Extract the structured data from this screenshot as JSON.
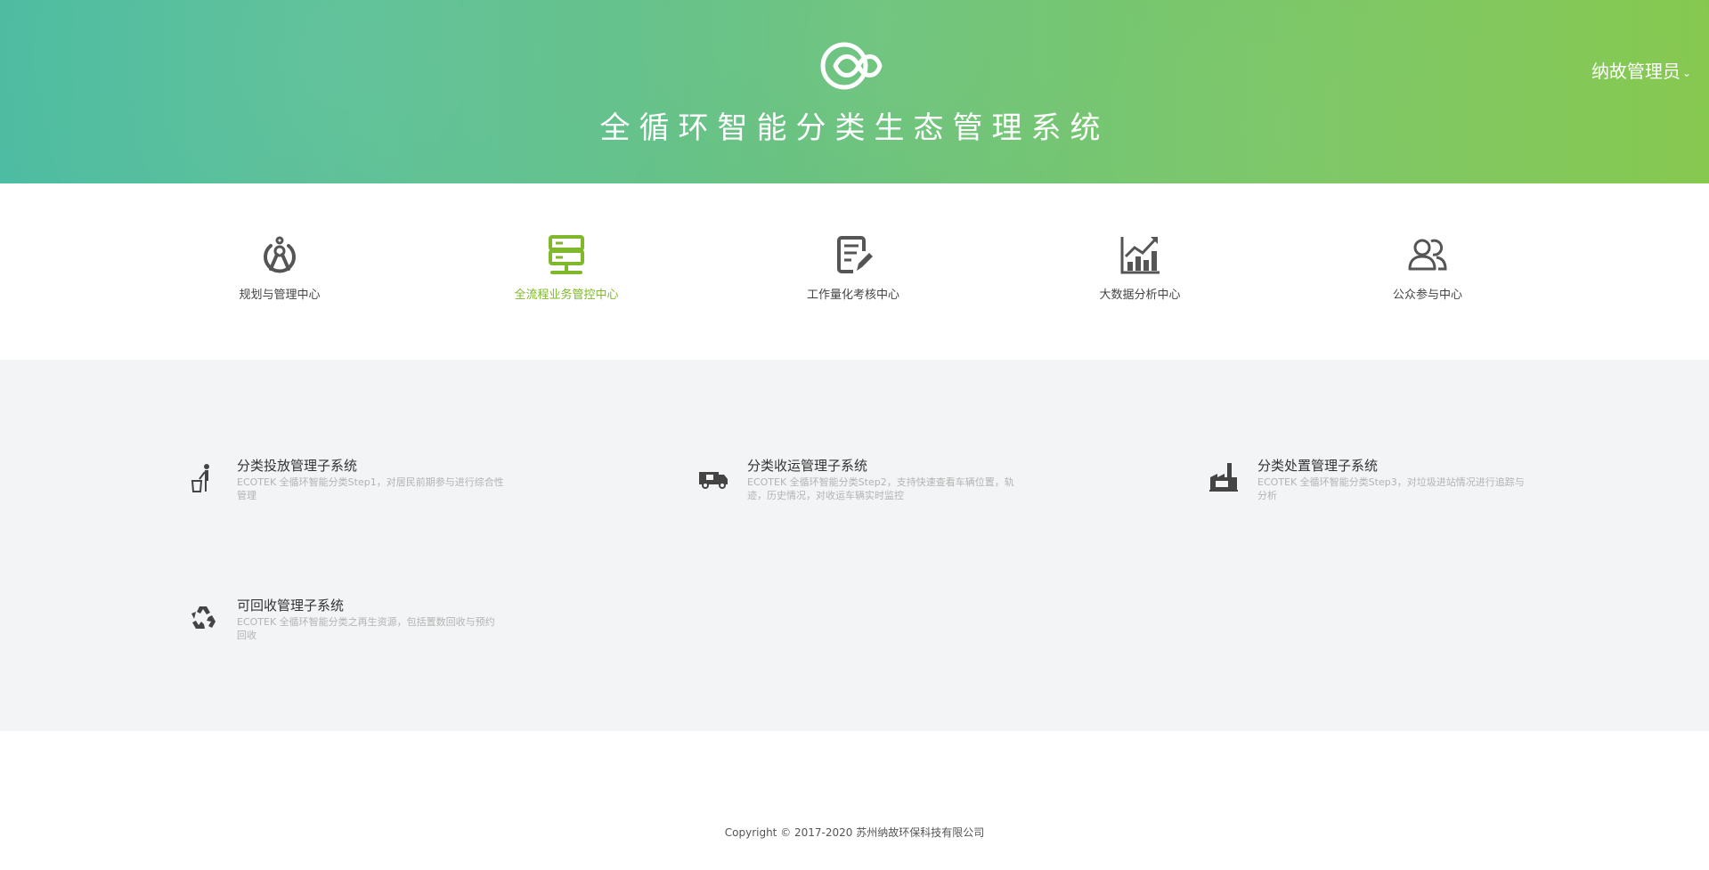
{
  "header": {
    "title": "全循环智能分类生态管理系统",
    "logo_icon": "infinity-loop-logo-icon",
    "user_label": "纳故管理员",
    "user_chevron": "⌄",
    "gradient_start": "#4bbba0",
    "gradient_end": "#85c84e"
  },
  "nav": {
    "accent_color": "#7fb82a",
    "items": [
      {
        "label": "规划与管理中心",
        "icon": "compass-planning-icon",
        "active": false
      },
      {
        "label": "全流程业务管控中心",
        "icon": "server-monitor-icon",
        "active": true
      },
      {
        "label": "工作量化考核中心",
        "icon": "document-edit-icon",
        "active": false
      },
      {
        "label": "大数据分析中心",
        "icon": "bar-chart-growth-icon",
        "active": false
      },
      {
        "label": "公众参与中心",
        "icon": "users-group-icon",
        "active": false
      }
    ]
  },
  "subsystems": [
    {
      "title": "分类投放管理子系统",
      "desc": "ECOTEK 全循环智能分类Step1，对居民前期参与进行综合性管理",
      "icon": "person-trash-bin-icon"
    },
    {
      "title": "分类收运管理子系统",
      "desc": "ECOTEK 全循环智能分类Step2，支持快速查看车辆位置，轨迹，历史情况，对收运车辆实时监控",
      "icon": "garbage-truck-icon"
    },
    {
      "title": "分类处置管理子系统",
      "desc": "ECOTEK 全循环智能分类Step3，对垃圾进站情况进行追踪与分析",
      "icon": "factory-plant-icon"
    },
    {
      "title": "可回收管理子系统",
      "desc": "ECOTEK 全循环智能分类之再生资源，包括置数回收与预约回收",
      "icon": "recycle-icon"
    }
  ],
  "footer": {
    "copyright": "Copyright © 2017-2020 苏州纳故环保科技有限公司"
  }
}
